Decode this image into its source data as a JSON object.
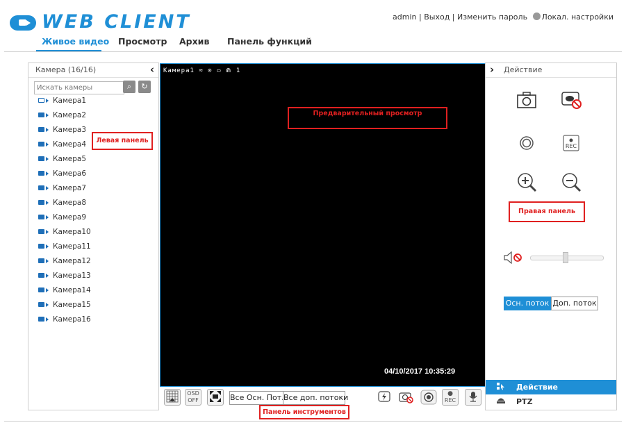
{
  "header": {
    "logo_text": "WEB CLIENT",
    "user": "admin",
    "logout": "Выход",
    "change_password": "Изменить пароль",
    "local_settings": "Локал. настройки",
    "separator": "|"
  },
  "nav": {
    "tabs": [
      {
        "label": "Живое видео",
        "active": true
      },
      {
        "label": "Просмотр",
        "active": false
      },
      {
        "label": "Архив",
        "active": false
      },
      {
        "label": "Панель функций",
        "active": false
      }
    ]
  },
  "left_panel": {
    "title": "Камера (16/16)",
    "search_placeholder": "Искать камеры",
    "cameras": [
      "Камера1",
      "Камера2",
      "Камера3",
      "Камера4",
      "Камера5",
      "Камера6",
      "Камера7",
      "Камера8",
      "Камера9",
      "Камера10",
      "Камера11",
      "Камера12",
      "Камера13",
      "Камера14",
      "Камера15",
      "Камера16"
    ]
  },
  "video": {
    "top_overlay": "Камера1  ≈ ⊙ ▭ ⋒ 1",
    "timestamp": "04/10/2017 10:35:29"
  },
  "toolbar": {
    "osd_label": "OSD",
    "osd_state": "OFF",
    "all_main_streams": "Все Осн. Пот.",
    "all_sub_streams": "Все доп. потоки",
    "rec_label": "REC"
  },
  "right_panel": {
    "title": "Действие",
    "rec_label": "REC",
    "main_stream": "Осн. поток",
    "sub_stream": "Доп. поток",
    "tabs": [
      {
        "label": "Действие",
        "active": true
      },
      {
        "label": "PTZ",
        "active": false
      }
    ]
  },
  "annotations": {
    "left": "Левая панель",
    "preview": "Предварительный просмотр",
    "right": "Правая панель",
    "toolbar": "Панель инструментов"
  },
  "colors": {
    "accent": "#1f8fd6",
    "annotation": "#e02020"
  }
}
